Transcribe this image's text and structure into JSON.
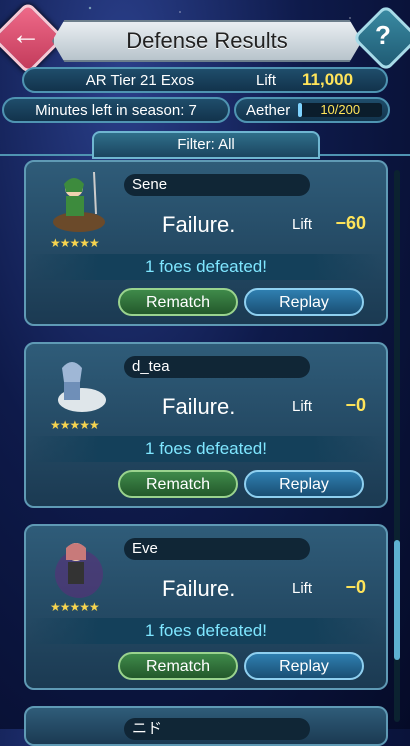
{
  "header": {
    "title": "Defense Results",
    "back_icon": "back-arrow-icon",
    "help_icon": "question-icon"
  },
  "tier": {
    "text": "AR Tier 21   Exos",
    "lift_label": "Lift",
    "lift_value": "11,000"
  },
  "season": {
    "text": "Minutes left in season: 7"
  },
  "aether": {
    "label": "Aether",
    "value": "10/200",
    "current": 10,
    "max": 200
  },
  "filter": {
    "label": "Filter: All"
  },
  "results": [
    {
      "name": "Sene",
      "result": "Failure.",
      "lift_label": "Lift",
      "lift": "−60",
      "foes": "1 foes defeated!",
      "rematch": "Rematch",
      "replay": "Replay",
      "stars": "★★★★★",
      "accent": "#3d8b3d"
    },
    {
      "name": "d_tea",
      "result": "Failure.",
      "lift_label": "Lift",
      "lift": "−0",
      "foes": "1 foes defeated!",
      "rematch": "Rematch",
      "replay": "Replay",
      "stars": "★★★★★",
      "accent": "#9fb7d6"
    },
    {
      "name": "Eve",
      "result": "Failure.",
      "lift_label": "Lift",
      "lift": "−0",
      "foes": "1 foes defeated!",
      "rematch": "Rematch",
      "replay": "Replay",
      "stars": "★★★★★",
      "accent": "#c87a7a"
    }
  ],
  "partial_card": {
    "name": "ニド"
  }
}
